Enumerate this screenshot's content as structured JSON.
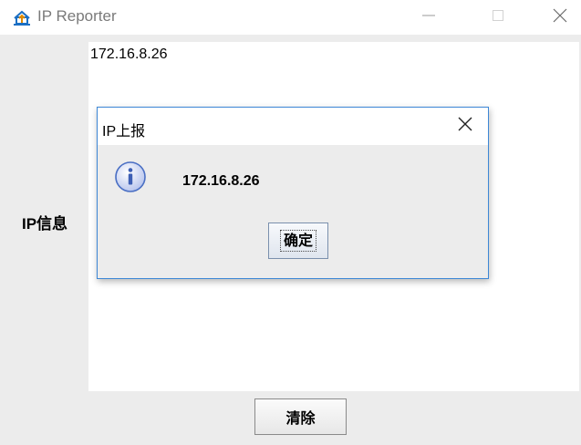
{
  "window": {
    "title": "IP Reporter",
    "icon": "house-upload-icon",
    "controls": [
      "minimize-icon",
      "maximize-icon",
      "close-icon"
    ]
  },
  "main": {
    "info_label": "IP信息",
    "info_text": "172.16.8.26",
    "clear_label": "清除"
  },
  "dialog": {
    "title": "IP上报",
    "icon": "info-icon",
    "message": "172.16.8.26",
    "ok_label": "确定"
  },
  "colors": {
    "dialog_border": "#3d87d6",
    "panel_bg": "#ececec",
    "info_icon_fill": "#cbd5f2",
    "info_icon_stroke": "#4a6fc4"
  }
}
